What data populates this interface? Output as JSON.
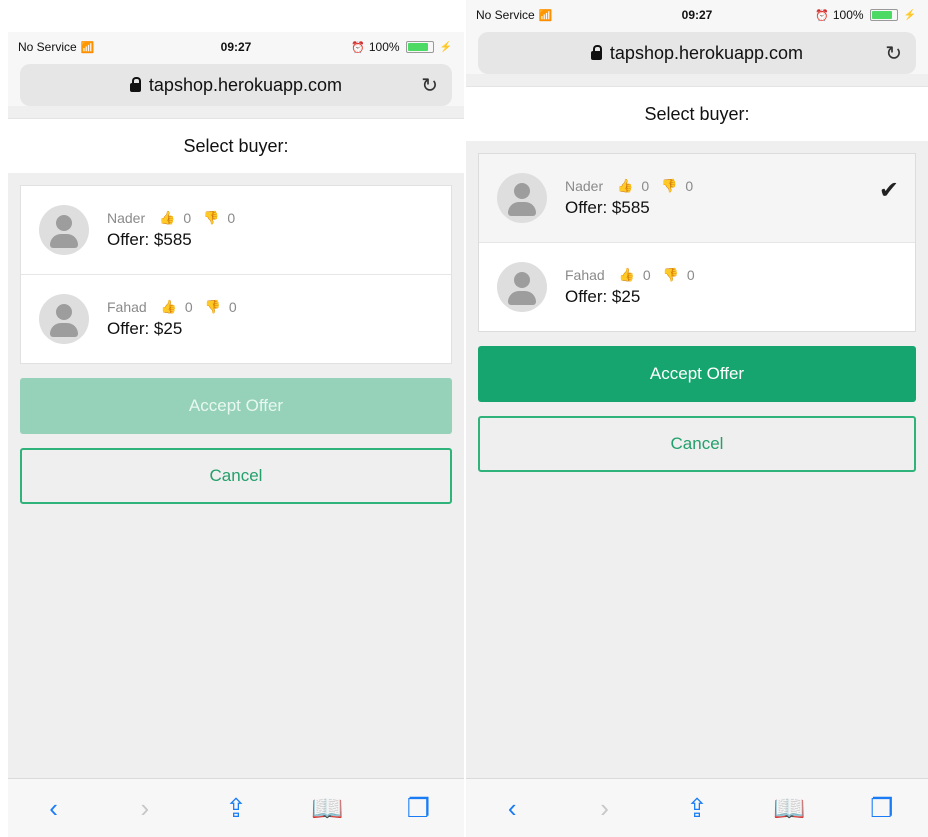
{
  "screens": [
    {
      "status": {
        "carrier": "No Service",
        "time": "09:27",
        "battery": "100%"
      },
      "browser": {
        "url": "tapshop.herokuapp.com"
      },
      "page": {
        "title": "Select buyer:",
        "buyers": [
          {
            "name": "Nader",
            "likes": "0",
            "dislikes": "0",
            "offer": "Offer: $585"
          },
          {
            "name": "Fahad",
            "likes": "0",
            "dislikes": "0",
            "offer": "Offer: $25"
          }
        ],
        "accept_label": "Accept Offer",
        "cancel_label": "Cancel"
      }
    },
    {
      "status": {
        "carrier": "No Service",
        "time": "09:27",
        "battery": "100%"
      },
      "browser": {
        "url": "tapshop.herokuapp.com"
      },
      "page": {
        "title": "Select buyer:",
        "buyers": [
          {
            "name": "Nader",
            "likes": "0",
            "dislikes": "0",
            "offer": "Offer: $585"
          },
          {
            "name": "Fahad",
            "likes": "0",
            "dislikes": "0",
            "offer": "Offer: $25"
          }
        ],
        "accept_label": "Accept Offer",
        "cancel_label": "Cancel"
      }
    }
  ],
  "colors": {
    "accent": "#16a56f",
    "accent_disabled": "#95d2b9",
    "like": "#3aa63f",
    "dislike": "#c9434c",
    "link": "#1a7cf5"
  }
}
